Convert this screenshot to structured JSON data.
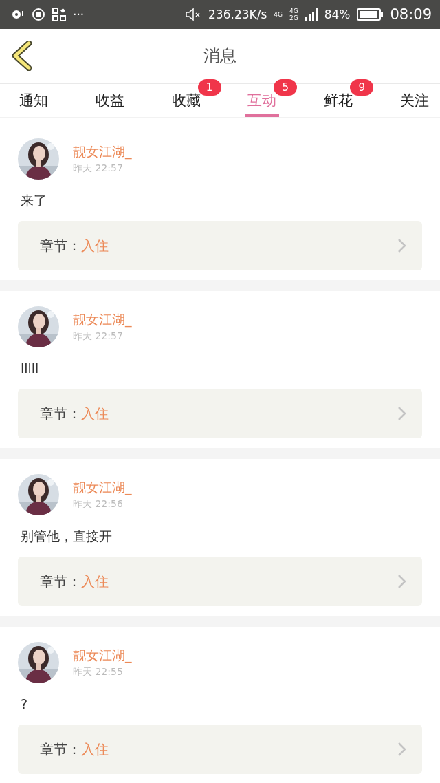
{
  "status_bar": {
    "more": "···",
    "speed": "236.23K/s",
    "net_top": "4G",
    "net_a": "4G",
    "net_b": "2G",
    "battery": "84%",
    "time": "08:09"
  },
  "header": {
    "title": "消息"
  },
  "tabs": [
    {
      "label": "通知",
      "selected": false
    },
    {
      "label": "收益",
      "selected": false
    },
    {
      "label": "收藏",
      "selected": false,
      "badge": "1"
    },
    {
      "label": "互动",
      "selected": true,
      "badge": "5"
    },
    {
      "label": "鲜花",
      "selected": false,
      "badge": "9"
    },
    {
      "label": "关注",
      "selected": false
    }
  ],
  "messages": [
    {
      "user": "靓女江湖_",
      "time": "昨天 22:57",
      "text": "来了",
      "chapter_label": "章节：",
      "chapter": "入住"
    },
    {
      "user": "靓女江湖_",
      "time": "昨天 22:57",
      "text": "lllll",
      "chapter_label": "章节：",
      "chapter": "入住"
    },
    {
      "user": "靓女江湖_",
      "time": "昨天 22:56",
      "text": "别管他，直接开",
      "chapter_label": "章节：",
      "chapter": "入住"
    },
    {
      "user": "靓女江湖_",
      "time": "昨天 22:55",
      "text": "?",
      "chapter_label": "章节：",
      "chapter": "入住"
    }
  ]
}
